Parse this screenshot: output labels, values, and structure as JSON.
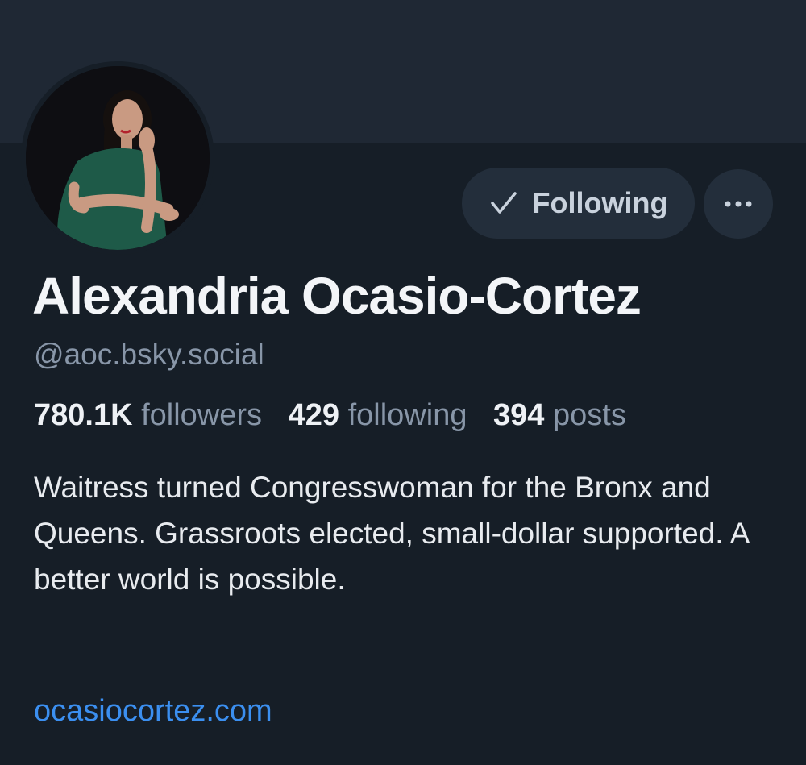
{
  "profile": {
    "display_name": "Alexandria Ocasio-Cortez",
    "handle": "@aoc.bsky.social",
    "bio": "Waitress turned Congresswoman for the Bronx and Queens. Grassroots elected, small-dollar supported. A better world is possible.",
    "website": "ocasiocortez.com"
  },
  "stats": {
    "followers_count": "780.1K",
    "followers_label": "followers",
    "following_count": "429",
    "following_label": "following",
    "posts_count": "394",
    "posts_label": "posts"
  },
  "actions": {
    "following_label": "Following",
    "check_icon": "check-icon",
    "more_icon": "ellipsis-icon"
  },
  "colors": {
    "background": "#161e27",
    "banner": "#1f2834",
    "button": "#232e3b",
    "link": "#3b8ff0",
    "muted_text": "#8896a8"
  }
}
